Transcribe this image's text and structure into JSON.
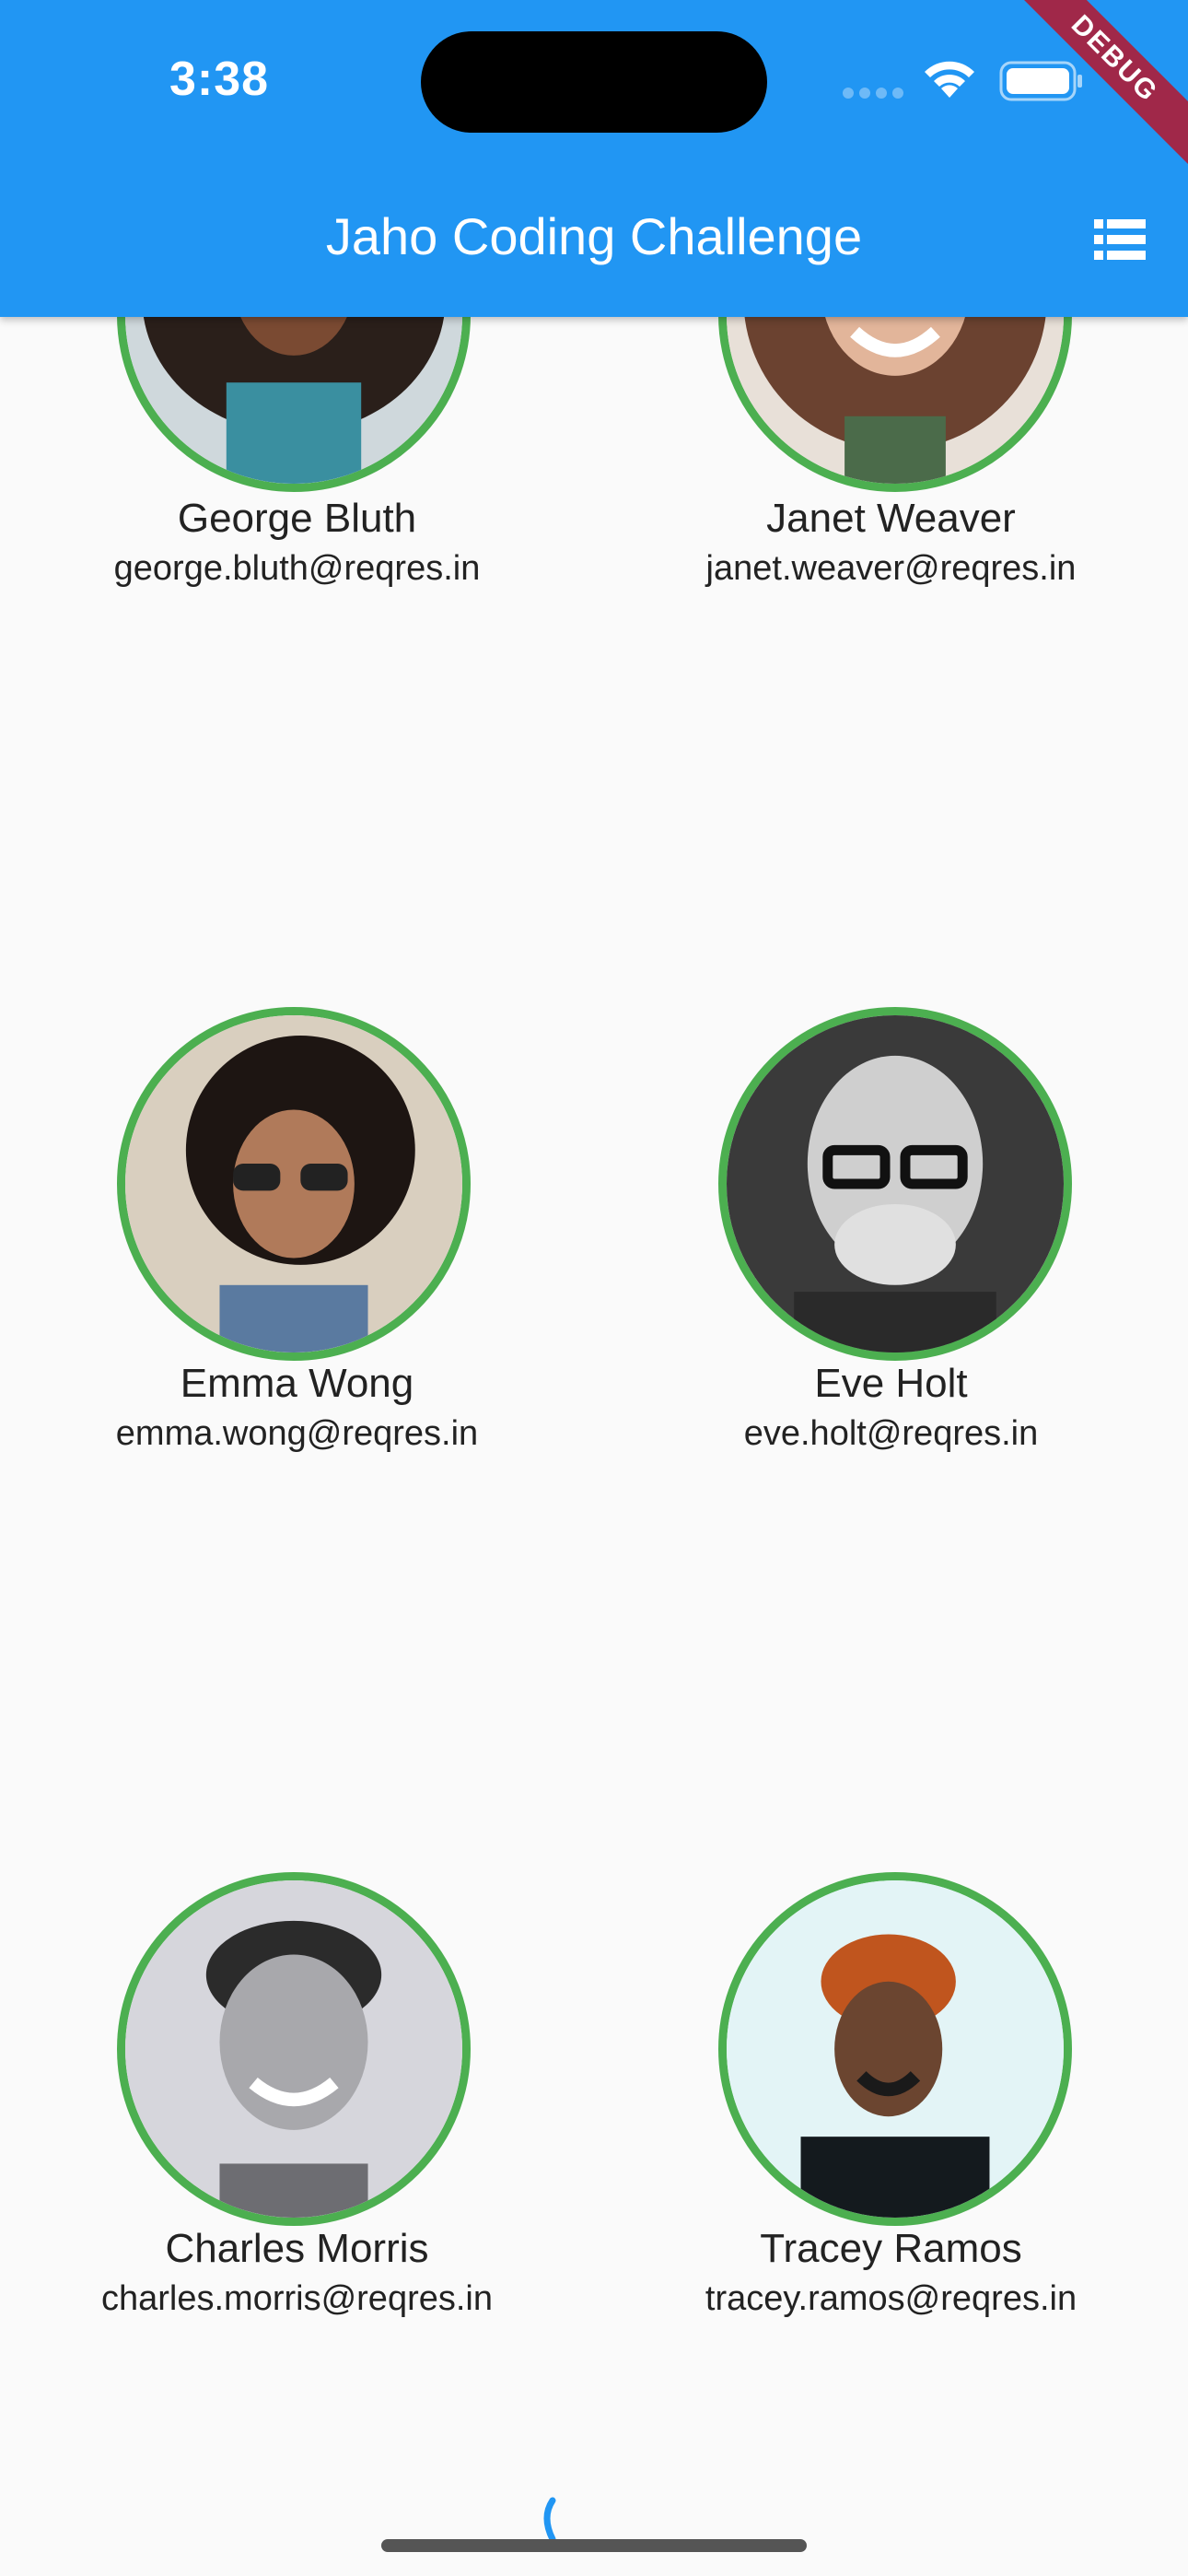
{
  "status_bar": {
    "time": "3:38"
  },
  "app_bar": {
    "title": "Jaho Coding Challenge",
    "action_icon": "list-view-icon"
  },
  "debug_banner": "DEBUG",
  "users": [
    {
      "name": "George Bluth",
      "email": "george.bluth@reqres.in"
    },
    {
      "name": "Janet Weaver",
      "email": "janet.weaver@reqres.in"
    },
    {
      "name": "Emma Wong",
      "email": "emma.wong@reqres.in"
    },
    {
      "name": "Eve Holt",
      "email": "eve.holt@reqres.in"
    },
    {
      "name": "Charles Morris",
      "email": "charles.morris@reqres.in"
    },
    {
      "name": "Tracey Ramos",
      "email": "tracey.ramos@reqres.in"
    }
  ],
  "colors": {
    "app_bar": "#2196F3",
    "avatar_ring": "#4CAF50",
    "background": "#FAFAFA",
    "debug_banner": "#A02849"
  }
}
